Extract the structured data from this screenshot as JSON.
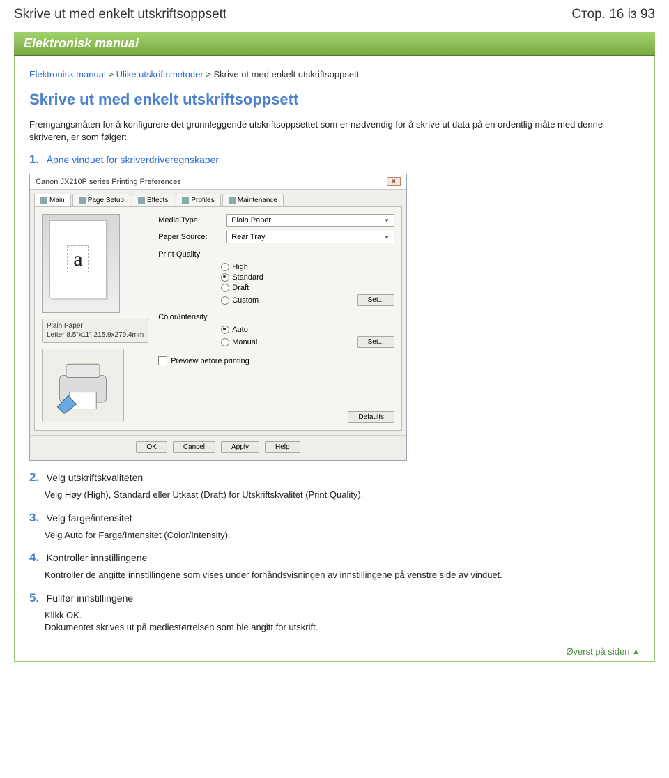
{
  "header": {
    "title": "Skrive ut med enkelt utskriftsoppsett",
    "page_indicator": "Стор. 16 із 93"
  },
  "manual_bar": "Elektronisk manual",
  "breadcrumb": {
    "items": [
      {
        "text": "Elektronisk manual",
        "link": true
      },
      {
        "text": "Ulike utskriftsmetoder",
        "link": true
      },
      {
        "text": "Skrive ut med enkelt utskriftsoppsett",
        "link": false
      }
    ],
    "sep": " > "
  },
  "section_title": "Skrive ut med enkelt utskriftsoppsett",
  "intro": "Fremgangsmåten for å konfigurere det grunnleggende utskriftsoppsettet som er nødvendig for å skrive ut data på en ordentlig måte med denne skriveren, er som følger:",
  "steps": [
    {
      "num": "1.",
      "title": "Åpne vinduet for skriverdriveregnskaper",
      "title_link": true
    },
    {
      "num": "2.",
      "title": "Velg utskriftskvaliteten",
      "body": "Velg Høy (High), Standard eller Utkast (Draft) for Utskriftskvalitet (Print Quality)."
    },
    {
      "num": "3.",
      "title": "Velg farge/intensitet",
      "body": "Velg Auto for Farge/Intensitet (Color/Intensity)."
    },
    {
      "num": "4.",
      "title": "Kontroller innstillingene",
      "body": "Kontroller de angitte innstillingene som vises under forhåndsvisningen av innstillingene på venstre side av vinduet."
    },
    {
      "num": "5.",
      "title": "Fullfør innstillingene",
      "body": "Klikk OK.\nDokumentet skrives ut på mediestørrelsen som ble angitt for utskrift."
    }
  ],
  "footer": {
    "top_of_page": "Øverst på siden"
  },
  "dialog": {
    "title": "Canon JX210P series Printing Preferences",
    "close": "×",
    "tabs": [
      "Main",
      "Page Setup",
      "Effects",
      "Profiles",
      "Maintenance"
    ],
    "media_type": {
      "label": "Media Type:",
      "value": "Plain Paper"
    },
    "paper_source": {
      "label": "Paper Source:",
      "value": "Rear Tray"
    },
    "print_quality": {
      "label": "Print Quality",
      "options": [
        "High",
        "Standard",
        "Draft",
        "Custom"
      ],
      "selected": "Standard"
    },
    "set_button": "Set...",
    "color_intensity": {
      "label": "Color/Intensity",
      "options": [
        "Auto",
        "Manual"
      ],
      "selected": "Auto"
    },
    "preview_check": "Preview before printing",
    "preview_info_line1": "Plain Paper",
    "preview_info_line2": "Letter 8.5\"x11\" 215.9x279.4mm",
    "defaults": "Defaults",
    "buttons": {
      "ok": "OK",
      "cancel": "Cancel",
      "apply": "Apply",
      "help": "Help"
    }
  }
}
